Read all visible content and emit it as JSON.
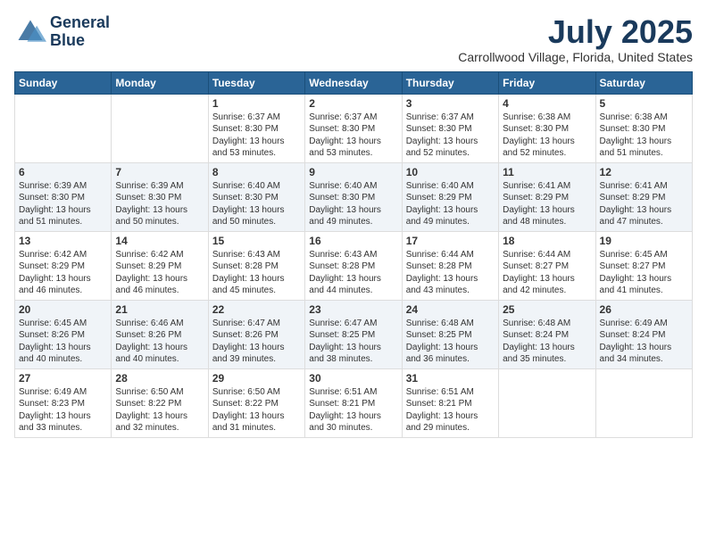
{
  "header": {
    "logo_line1": "General",
    "logo_line2": "Blue",
    "month_title": "July 2025",
    "location": "Carrollwood Village, Florida, United States"
  },
  "weekdays": [
    "Sunday",
    "Monday",
    "Tuesday",
    "Wednesday",
    "Thursday",
    "Friday",
    "Saturday"
  ],
  "weeks": [
    [
      {
        "day": "",
        "info": ""
      },
      {
        "day": "",
        "info": ""
      },
      {
        "day": "1",
        "info": "Sunrise: 6:37 AM\nSunset: 8:30 PM\nDaylight: 13 hours and 53 minutes."
      },
      {
        "day": "2",
        "info": "Sunrise: 6:37 AM\nSunset: 8:30 PM\nDaylight: 13 hours and 53 minutes."
      },
      {
        "day": "3",
        "info": "Sunrise: 6:37 AM\nSunset: 8:30 PM\nDaylight: 13 hours and 52 minutes."
      },
      {
        "day": "4",
        "info": "Sunrise: 6:38 AM\nSunset: 8:30 PM\nDaylight: 13 hours and 52 minutes."
      },
      {
        "day": "5",
        "info": "Sunrise: 6:38 AM\nSunset: 8:30 PM\nDaylight: 13 hours and 51 minutes."
      }
    ],
    [
      {
        "day": "6",
        "info": "Sunrise: 6:39 AM\nSunset: 8:30 PM\nDaylight: 13 hours and 51 minutes."
      },
      {
        "day": "7",
        "info": "Sunrise: 6:39 AM\nSunset: 8:30 PM\nDaylight: 13 hours and 50 minutes."
      },
      {
        "day": "8",
        "info": "Sunrise: 6:40 AM\nSunset: 8:30 PM\nDaylight: 13 hours and 50 minutes."
      },
      {
        "day": "9",
        "info": "Sunrise: 6:40 AM\nSunset: 8:30 PM\nDaylight: 13 hours and 49 minutes."
      },
      {
        "day": "10",
        "info": "Sunrise: 6:40 AM\nSunset: 8:29 PM\nDaylight: 13 hours and 49 minutes."
      },
      {
        "day": "11",
        "info": "Sunrise: 6:41 AM\nSunset: 8:29 PM\nDaylight: 13 hours and 48 minutes."
      },
      {
        "day": "12",
        "info": "Sunrise: 6:41 AM\nSunset: 8:29 PM\nDaylight: 13 hours and 47 minutes."
      }
    ],
    [
      {
        "day": "13",
        "info": "Sunrise: 6:42 AM\nSunset: 8:29 PM\nDaylight: 13 hours and 46 minutes."
      },
      {
        "day": "14",
        "info": "Sunrise: 6:42 AM\nSunset: 8:29 PM\nDaylight: 13 hours and 46 minutes."
      },
      {
        "day": "15",
        "info": "Sunrise: 6:43 AM\nSunset: 8:28 PM\nDaylight: 13 hours and 45 minutes."
      },
      {
        "day": "16",
        "info": "Sunrise: 6:43 AM\nSunset: 8:28 PM\nDaylight: 13 hours and 44 minutes."
      },
      {
        "day": "17",
        "info": "Sunrise: 6:44 AM\nSunset: 8:28 PM\nDaylight: 13 hours and 43 minutes."
      },
      {
        "day": "18",
        "info": "Sunrise: 6:44 AM\nSunset: 8:27 PM\nDaylight: 13 hours and 42 minutes."
      },
      {
        "day": "19",
        "info": "Sunrise: 6:45 AM\nSunset: 8:27 PM\nDaylight: 13 hours and 41 minutes."
      }
    ],
    [
      {
        "day": "20",
        "info": "Sunrise: 6:45 AM\nSunset: 8:26 PM\nDaylight: 13 hours and 40 minutes."
      },
      {
        "day": "21",
        "info": "Sunrise: 6:46 AM\nSunset: 8:26 PM\nDaylight: 13 hours and 40 minutes."
      },
      {
        "day": "22",
        "info": "Sunrise: 6:47 AM\nSunset: 8:26 PM\nDaylight: 13 hours and 39 minutes."
      },
      {
        "day": "23",
        "info": "Sunrise: 6:47 AM\nSunset: 8:25 PM\nDaylight: 13 hours and 38 minutes."
      },
      {
        "day": "24",
        "info": "Sunrise: 6:48 AM\nSunset: 8:25 PM\nDaylight: 13 hours and 36 minutes."
      },
      {
        "day": "25",
        "info": "Sunrise: 6:48 AM\nSunset: 8:24 PM\nDaylight: 13 hours and 35 minutes."
      },
      {
        "day": "26",
        "info": "Sunrise: 6:49 AM\nSunset: 8:24 PM\nDaylight: 13 hours and 34 minutes."
      }
    ],
    [
      {
        "day": "27",
        "info": "Sunrise: 6:49 AM\nSunset: 8:23 PM\nDaylight: 13 hours and 33 minutes."
      },
      {
        "day": "28",
        "info": "Sunrise: 6:50 AM\nSunset: 8:22 PM\nDaylight: 13 hours and 32 minutes."
      },
      {
        "day": "29",
        "info": "Sunrise: 6:50 AM\nSunset: 8:22 PM\nDaylight: 13 hours and 31 minutes."
      },
      {
        "day": "30",
        "info": "Sunrise: 6:51 AM\nSunset: 8:21 PM\nDaylight: 13 hours and 30 minutes."
      },
      {
        "day": "31",
        "info": "Sunrise: 6:51 AM\nSunset: 8:21 PM\nDaylight: 13 hours and 29 minutes."
      },
      {
        "day": "",
        "info": ""
      },
      {
        "day": "",
        "info": ""
      }
    ]
  ]
}
